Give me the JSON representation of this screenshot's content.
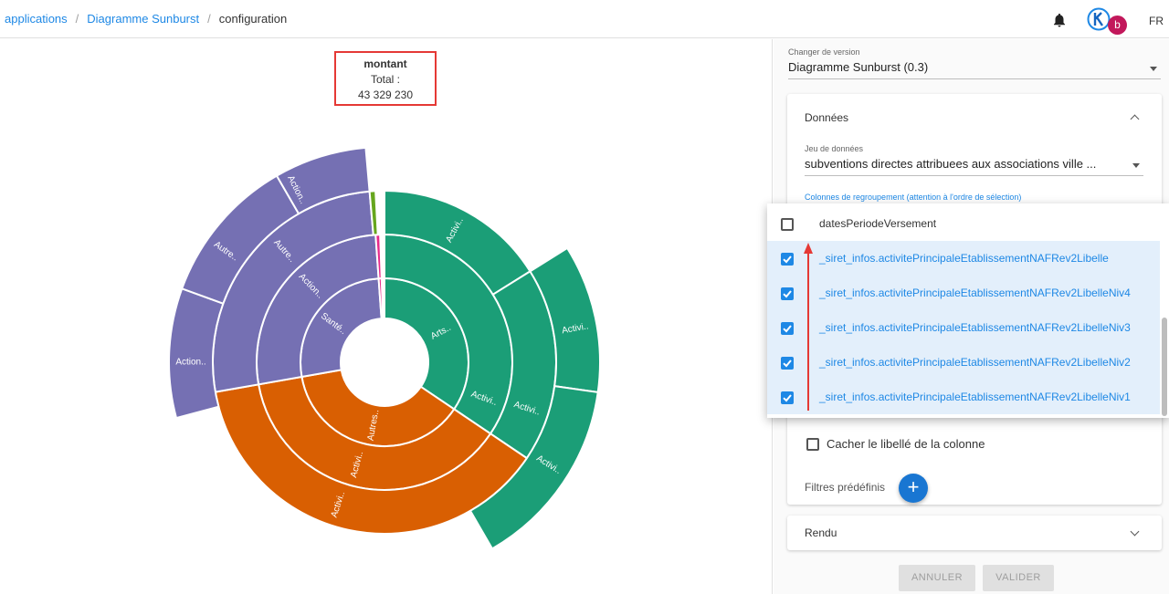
{
  "breadcrumb": {
    "items": [
      "applications",
      "Diagramme Sunburst"
    ],
    "current": "configuration"
  },
  "header": {
    "avatar_badge": "b",
    "language": "FR"
  },
  "chart_summary": {
    "measure": "montant",
    "total_label": "Total :",
    "total_value": "43 329 230"
  },
  "chart_data": {
    "type": "sunburst",
    "colors": {
      "purple": "#7570b3",
      "green": "#1b9e77",
      "orange": "#d95f02"
    },
    "ring_labels": {
      "level1": [
        "Santé..",
        "Arts..",
        "Autres.."
      ],
      "level2": [
        "Action..",
        "Activi..",
        "Activi.."
      ],
      "level3": [
        "Autre..",
        "Autre..",
        "Activi..",
        "Activi..",
        "Activi.."
      ],
      "level4": [
        "Action..",
        "Autre..",
        "Action..",
        "Activi..",
        "Activi.."
      ]
    }
  },
  "version": {
    "label": "Changer de version",
    "value": "Diagramme Sunburst (0.3)"
  },
  "donnees": {
    "title": "Données",
    "dataset_label": "Jeu de données",
    "dataset_value": "subventions directes attribuees aux associations ville ...",
    "group_label": "Colonnes de regroupement (attention à l'ordre de sélection)",
    "hide_label": "Cacher le libellé de la colonne",
    "filters_label": "Filtres prédéfinis",
    "add_icon": "+"
  },
  "dropdown": {
    "options": [
      {
        "label": "datesPeriodeVersement",
        "checked": false
      },
      {
        "label": "_siret_infos.activitePrincipaleEtablissementNAFRev2Libelle",
        "checked": true
      },
      {
        "label": "_siret_infos.activitePrincipaleEtablissementNAFRev2LibelleNiv4",
        "checked": true
      },
      {
        "label": "_siret_infos.activitePrincipaleEtablissementNAFRev2LibelleNiv3",
        "checked": true
      },
      {
        "label": "_siret_infos.activitePrincipaleEtablissementNAFRev2LibelleNiv2",
        "checked": true
      },
      {
        "label": "_siret_infos.activitePrincipaleEtablissementNAFRev2LibelleNiv1",
        "checked": true
      }
    ]
  },
  "rendu": {
    "title": "Rendu"
  },
  "buttons": {
    "cancel": "ANNULER",
    "validate": "VALIDER"
  }
}
